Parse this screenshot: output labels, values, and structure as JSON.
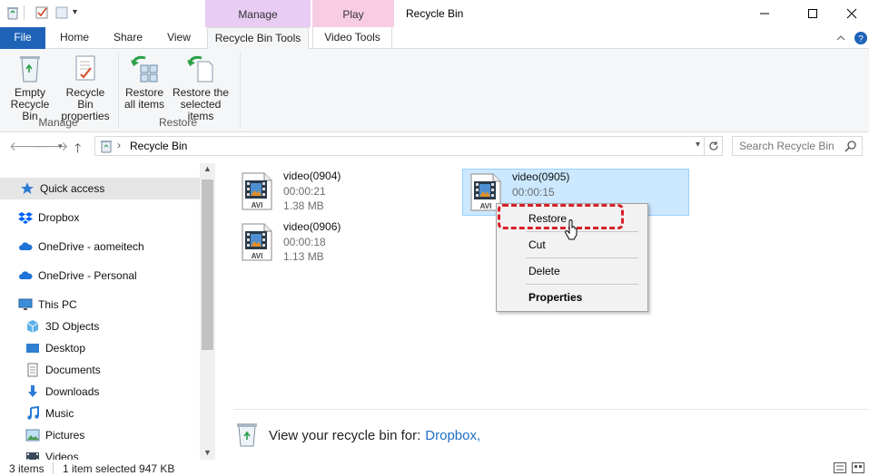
{
  "titlebar": {
    "window_title": "Recycle Bin",
    "context_groups": [
      "Manage",
      "Play"
    ]
  },
  "tabs": {
    "file": "File",
    "home": "Home",
    "share": "Share",
    "view": "View",
    "recycle_bin_tools": "Recycle Bin Tools",
    "video_tools": "Video Tools"
  },
  "ribbon": {
    "empty_line1": "Empty",
    "empty_line2": "Recycle Bin",
    "props_line1": "Recycle Bin",
    "props_line2": "properties",
    "manage_label": "Manage",
    "restore_all_line1": "Restore",
    "restore_all_line2": "all items",
    "restore_sel_line1": "Restore the",
    "restore_sel_line2": "selected items",
    "restore_label": "Restore"
  },
  "address": {
    "path": "Recycle Bin",
    "search_placeholder": "Search Recycle Bin"
  },
  "navpane": {
    "items": [
      {
        "label": "Quick access",
        "icon": "star-icon"
      },
      {
        "label": "Dropbox",
        "icon": "dropbox-icon"
      },
      {
        "label": "OneDrive - aomeitech",
        "icon": "onedrive-icon"
      },
      {
        "label": "OneDrive - Personal",
        "icon": "onedrive-icon"
      },
      {
        "label": "This PC",
        "icon": "computer-icon"
      },
      {
        "label": "3D Objects",
        "icon": "cube-icon"
      },
      {
        "label": "Desktop",
        "icon": "desktop-icon"
      },
      {
        "label": "Documents",
        "icon": "documents-icon"
      },
      {
        "label": "Downloads",
        "icon": "download-icon"
      },
      {
        "label": "Music",
        "icon": "music-icon"
      },
      {
        "label": "Pictures",
        "icon": "pictures-icon"
      },
      {
        "label": "Videos",
        "icon": "videos-icon"
      }
    ]
  },
  "files": [
    {
      "name": "video(0904)",
      "duration": "00:00:21",
      "size": "1.38 MB",
      "type": "AVI"
    },
    {
      "name": "video(0905)",
      "duration": "00:00:15",
      "size": "",
      "type": "AVI"
    },
    {
      "name": "video(0906)",
      "duration": "00:00:18",
      "size": "1.13 MB",
      "type": "AVI"
    }
  ],
  "context_menu": {
    "restore": "Restore",
    "cut": "Cut",
    "delete": "Delete",
    "properties": "Properties"
  },
  "footer": {
    "text": "View your recycle bin for:",
    "link": "Dropbox,"
  },
  "status": {
    "count": "3 items",
    "selection": "1 item selected  947 KB"
  },
  "colors": {
    "accent": "#1e63b8",
    "manage_tab": "#e8ccf3",
    "play_tab": "#f8cde4",
    "selection": "#cce8ff",
    "highlight": "#d7202a"
  }
}
